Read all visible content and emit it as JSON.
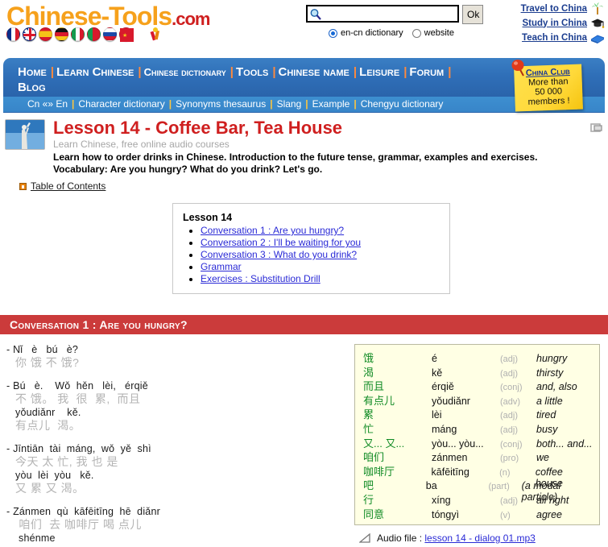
{
  "site": {
    "logo_main": "Chinese-Tools",
    "logo_tld": ".com",
    "flags": [
      {
        "name": "flag-france",
        "label": "French"
      },
      {
        "name": "flag-uk",
        "label": "English"
      },
      {
        "name": "flag-spain",
        "label": "Spanish"
      },
      {
        "name": "flag-germany",
        "label": "German"
      },
      {
        "name": "flag-italy",
        "label": "Italian"
      },
      {
        "name": "flag-portugal",
        "label": "Portuguese"
      },
      {
        "name": "flag-russia",
        "label": "Russian"
      },
      {
        "name": "flag-china",
        "label": "Chinese"
      }
    ],
    "firecracker_icon": "firecracker-icon"
  },
  "search": {
    "value": "",
    "placeholder": "",
    "icon": "magnifier-icon",
    "ok_label": "Ok",
    "options": [
      {
        "label": "en-cn dictionary",
        "checked": true
      },
      {
        "label": "website",
        "checked": false
      }
    ]
  },
  "toplinks": [
    {
      "label": "Travel to China",
      "icon": "palm-tree-icon"
    },
    {
      "label": "Study in China",
      "icon": "graduation-cap-icon"
    },
    {
      "label": "Teach in China",
      "icon": "blue-book-icon"
    }
  ],
  "nav": {
    "main": [
      "Home",
      "Learn Chinese",
      "Chinese dictionary",
      "Tools",
      "Chinese name",
      "Leisure",
      "Forum",
      "Blog"
    ],
    "sub": [
      "Cn «» En",
      "Character dictionary",
      "Synonyms thesaurus",
      "Slang",
      "Example",
      "Chengyu dictionary"
    ]
  },
  "china_club": {
    "title": "China Club",
    "line1": "More than",
    "line2": "50 000",
    "line3": "members !",
    "pin_icon": "pushpin-icon"
  },
  "lesson": {
    "thumb_icon": "statue-photo-thumbnail",
    "title": "Lesson 14 - Coffee Bar, Tea House",
    "subtitle": "Learn Chinese, free online audio courses",
    "description_line1": "Learn how to order drinks in Chinese. Introduction to the future tense, grammar, examples and exercises.",
    "description_line2": "Vocabulary: Are you hungry? What do you drink? Let's go.",
    "toc_label": "Table of Contents",
    "toc_bullet_icon": "orange-square-bullet-icon",
    "print_icon": "print-page-icon"
  },
  "contents_box": {
    "heading": "Lesson 14",
    "items": [
      "Conversation 1 : Are you hungry?",
      "Conversation 2 : I'll be waiting for you",
      "Conversation 3 : What do you drink?",
      "Grammar",
      "Exercises : Substitution Drill"
    ]
  },
  "conversation": {
    "header": "Conversation 1 : Are you hungry?",
    "lines": [
      {
        "dash": "-",
        "pinyin_1": "Nǐ   è   bú   è?",
        "hanzi_1": "你 饿 不 饿?",
        "pinyin_2": "",
        "hanzi_2": ""
      },
      {
        "dash": "-",
        "pinyin_1": "Bú   è.    Wǒ  hěn   lèi,   érqiě",
        "hanzi_1": "不 饿。 我  很  累,  而且",
        "pinyin_2": "yǒudiǎnr    kě.",
        "hanzi_2": "有点儿  渴。"
      },
      {
        "dash": "-",
        "pinyin_1": "Jīntiān  tài  máng,  wǒ  yě  shì",
        "hanzi_1": "今天 太 忙, 我 也 是",
        "pinyin_2": "yòu  lèi  yòu   kě.",
        "hanzi_2": "又 累 又 渴。"
      },
      {
        "dash": "-",
        "pinyin_1": "Zánmen  qù  kāfēitīng  hē  diǎnr",
        "hanzi_1": " 咱们  去 咖啡厅 喝 点儿",
        "pinyin_2": "shénme",
        "hanzi_2": ""
      }
    ]
  },
  "vocabulary": {
    "rows": [
      {
        "hanzi": "饿",
        "pinyin": "é",
        "pos": "(adj)",
        "english": "hungry"
      },
      {
        "hanzi": "渴",
        "pinyin": "kě",
        "pos": "(adj)",
        "english": "thirsty"
      },
      {
        "hanzi": "而且",
        "pinyin": "érqiě",
        "pos": "(conj)",
        "english": "and, also"
      },
      {
        "hanzi": "有点儿",
        "pinyin": "yǒudiǎnr",
        "pos": "(adv)",
        "english": "a little"
      },
      {
        "hanzi": "累",
        "pinyin": "lèi",
        "pos": "(adj)",
        "english": "tired"
      },
      {
        "hanzi": "忙",
        "pinyin": "máng",
        "pos": "(adj)",
        "english": "busy"
      },
      {
        "hanzi": "又... 又...",
        "pinyin": "yòu... yòu...",
        "pos": "(conj)",
        "english": "both... and..."
      },
      {
        "hanzi": "咱们",
        "pinyin": "zánmen",
        "pos": "(pro)",
        "english": "we"
      },
      {
        "hanzi": "咖啡厅",
        "pinyin": "kāfēitīng",
        "pos": "(n)",
        "english": "coffee house"
      },
      {
        "hanzi": "吧",
        "pinyin": "ba",
        "pos": "(part)",
        "english": "(a modal particle)"
      },
      {
        "hanzi": "行",
        "pinyin": "xíng",
        "pos": "(adj)",
        "english": "all right"
      },
      {
        "hanzi": "同意",
        "pinyin": "tóngyì",
        "pos": "(v)",
        "english": "agree"
      }
    ]
  },
  "audio": {
    "icon": "speaker-icon",
    "prefix": "Audio file : ",
    "filename": "lesson 14 - dialog 01.mp3"
  },
  "colors": {
    "brand_orange": "#f6a11c",
    "brand_red": "#cf1f1f",
    "nav_blue": "#2f6fb8",
    "conv_red": "#cb3b3b",
    "vocab_green": "#0f8a23",
    "link_blue": "#2a2ad6"
  }
}
